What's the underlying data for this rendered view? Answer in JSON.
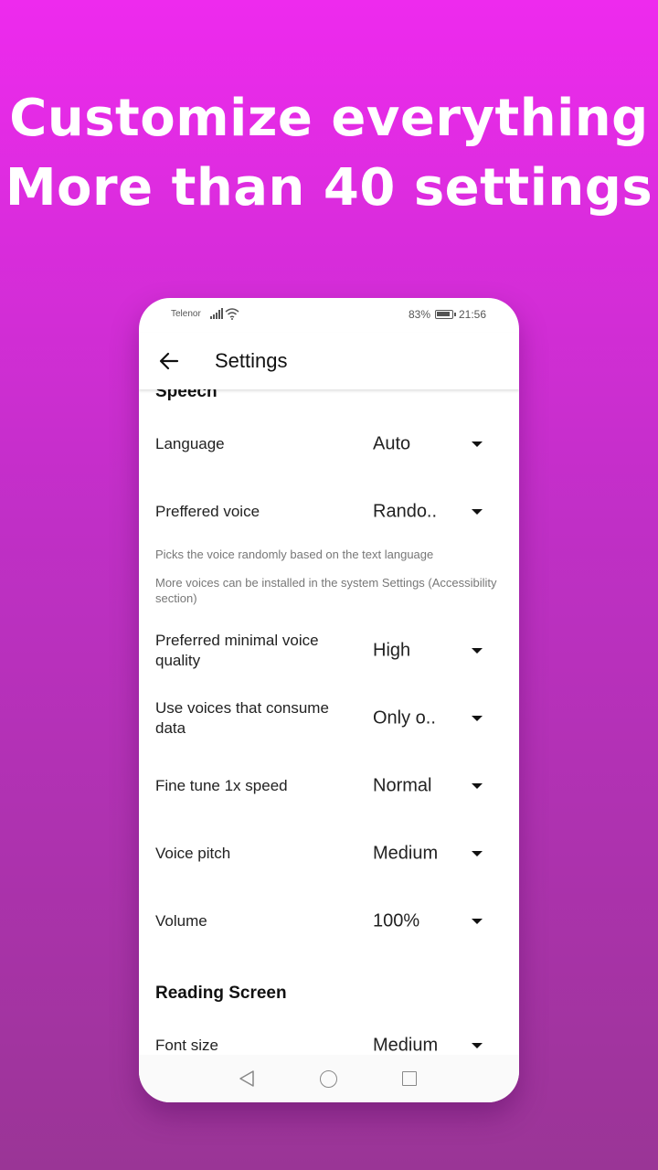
{
  "headline": {
    "line1": "Customize everything",
    "line2": "More than 40 settings"
  },
  "status_bar": {
    "carrier": "Telenor",
    "battery": "83%",
    "time": "21:56"
  },
  "toolbar": {
    "title": "Settings"
  },
  "sections": {
    "speech": {
      "title": "Speech",
      "language": {
        "label": "Language",
        "value": "Auto"
      },
      "preferred_voice": {
        "label": "Preffered voice",
        "value": "Rando.."
      },
      "hint1": "Picks the voice randomly based on the text language",
      "hint2": "More voices can be installed in the system Settings (Accessibility section)",
      "quality": {
        "label": "Preferred minimal voice quality",
        "value": "High"
      },
      "data_voices": {
        "label": "Use voices that consume data",
        "value": "Only o.."
      },
      "speed": {
        "label": "Fine tune 1x speed",
        "value": "Normal"
      },
      "pitch": {
        "label": "Voice pitch",
        "value": "Medium"
      },
      "volume": {
        "label": "Volume",
        "value": "100%"
      }
    },
    "reading_screen": {
      "title": "Reading Screen",
      "font_size": {
        "label": "Font size",
        "value": "Medium"
      }
    }
  }
}
